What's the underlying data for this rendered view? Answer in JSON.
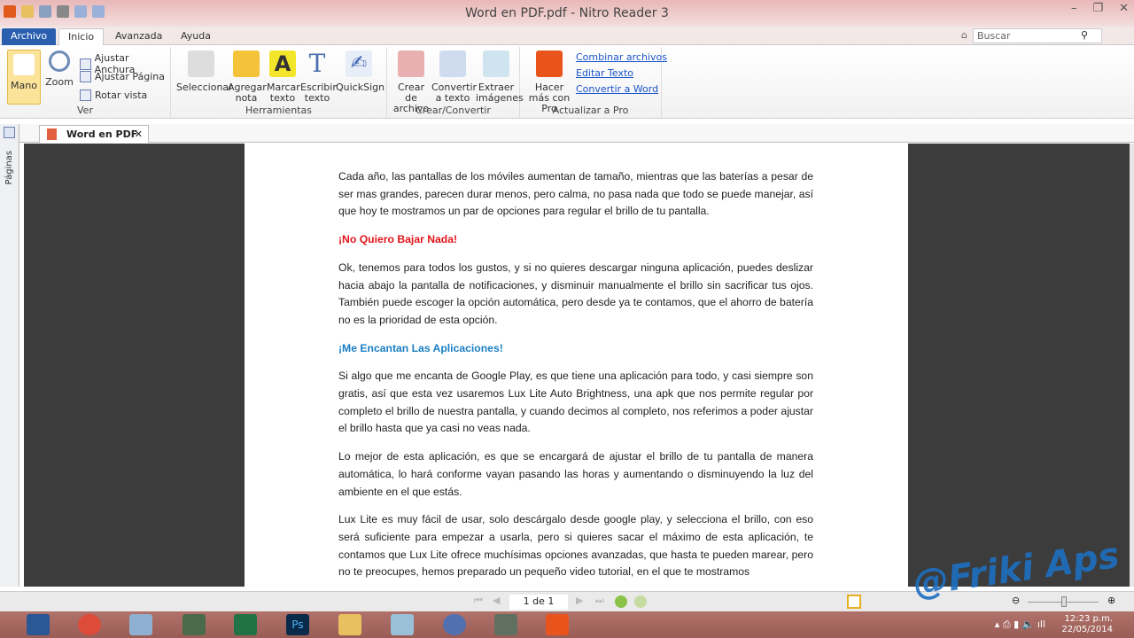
{
  "window": {
    "title": "Word en PDF.pdf - Nitro Reader 3"
  },
  "menu_tabs": [
    "Archivo",
    "Inicio",
    "Avanzada",
    "Ayuda"
  ],
  "search": {
    "placeholder": "Buscar"
  },
  "ribbon": {
    "ver": {
      "label": "Ver",
      "mano": "Mano",
      "zoom": "Zoom",
      "ajustar_anchura": "Ajustar Anchura",
      "ajustar_pagina": "Ajustar Página",
      "rotar": "Rotar vista"
    },
    "herramientas": {
      "label": "Herramientas",
      "seleccionar": "Seleccionar",
      "agregar_nota": "Agregar nota",
      "marcar_texto": "Marcar texto",
      "escribir_texto": "Escribir texto",
      "quicksign": "QuickSign"
    },
    "crear": {
      "label": "Crear/Convertir",
      "crear_archivo": "Crear de archivo",
      "convertir_texto": "Convertir a texto",
      "extraer": "Extraer imágenes"
    },
    "pro": {
      "label": "Actualizar a Pro",
      "hacer_mas": "Hacer más con Pro",
      "links": [
        "Combinar archivos",
        "Editar Texto",
        "Convertir a Word"
      ]
    }
  },
  "document_tab": "Word en PDF",
  "side_panel": "Páginas",
  "document": {
    "p1": "Cada año, las pantallas de los móviles aumentan de tamaño, mientras que las baterías a pesar de ser mas grandes, parecen durar menos, pero calma, no pasa nada que todo se puede manejar, así que hoy te mostramos un par de opciones para regular el brillo de tu pantalla.",
    "h1": "¡No Quiero Bajar Nada!",
    "p2": "Ok, tenemos para todos los gustos, y si no quieres descargar ninguna aplicación, puedes deslizar hacia abajo la pantalla de notificaciones, y disminuir manualmente el brillo sin sacrificar tus ojos. También puede escoger la opción automática, pero desde ya te contamos, que el ahorro de batería no es la prioridad de esta opción.",
    "h2": "¡Me Encantan Las Aplicaciones!",
    "p3": "Si algo que me encanta de Google Play, es que tiene una aplicación para todo, y casi siempre son gratis, así que esta vez usaremos Lux Lite Auto Brightness, una apk que nos permite regular por completo el brillo de nuestra pantalla, y cuando decimos al completo, nos referimos a poder ajustar el brillo hasta que ya casi no veas nada.",
    "p4": "Lo mejor de esta aplicación, es que se encargará de ajustar el brillo de tu pantalla de manera automática, lo hará conforme vayan pasando las horas y aumentando o disminuyendo la luz del ambiente en el que estás.",
    "p5": "Lux Lite es muy fácil de usar, solo descárgalo desde google play, y selecciona el brillo, con eso será suficiente para empezar a usarla, pero si quieres sacar el máximo de esta aplicación, te contamos que Lux Lite ofrece muchísimas opciones avanzadas, que hasta te pueden marear, pero no te preocupes, hemos preparado un pequeño video tutorial, en el que te mostramos"
  },
  "status": {
    "page": "1 de 1"
  },
  "watermark": "@Friki Aps",
  "clock": {
    "time": "12:23 p.m.",
    "date": "22/05/2014"
  },
  "colors": {
    "accent": "#2a5faf",
    "heading_red": "#e0151b",
    "heading_blue": "#1b7fc4"
  }
}
